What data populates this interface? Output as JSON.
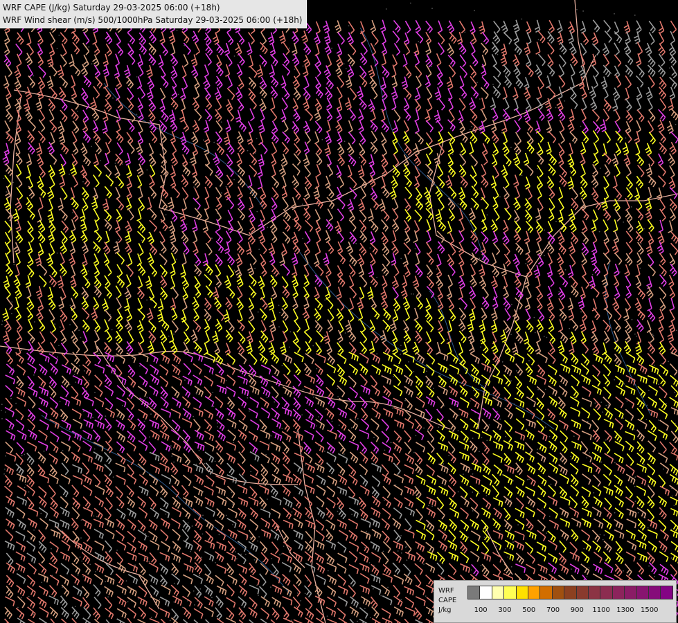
{
  "title": {
    "line1": "WRF CAPE (J/kg) Saturday 29-03-2025 06:00 (+18h)",
    "line2": "WRF Wind shear (m/s) 500/1000hPa Saturday 29-03-2025 06:00 (+18h)"
  },
  "legend": {
    "model": "WRF",
    "field": "CAPE",
    "unit": "J/kg",
    "swatches": [
      "#7a7a7a",
      "#ffffff",
      "#ffffb0",
      "#ffff55",
      "#ffe000",
      "#ffa200",
      "#d26e00",
      "#a05010",
      "#8c4020",
      "#8a3a2e",
      "#8c3444",
      "#8c2c50",
      "#8c245c",
      "#8a1c66",
      "#881470",
      "#860c7a",
      "#840484"
    ],
    "ticks": [
      "100",
      "300",
      "500",
      "700",
      "900",
      "1100",
      "1300",
      "1500"
    ]
  },
  "colors": {
    "yellow_barb": "#ffff22",
    "magenta_barb": "#e23ee6",
    "salmon_barb": "#e2786c",
    "tan_barb": "#d7a080",
    "grey_barb": "#9c9c9c",
    "border": "#e8b0a0",
    "river": "#3a6fae"
  }
}
